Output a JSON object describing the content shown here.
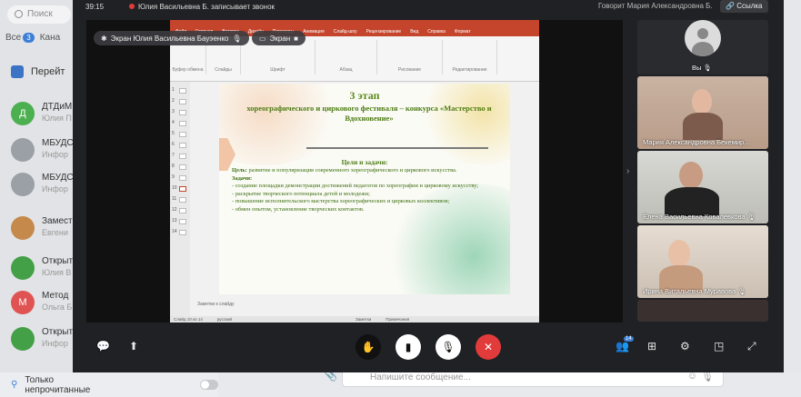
{
  "sidebar": {
    "search_placeholder": "Поиск",
    "filters": [
      {
        "label": "Все",
        "badge": "3"
      },
      {
        "label": "Кана"
      }
    ],
    "goto_label": "Перейт",
    "chats": [
      {
        "initial": "Д",
        "title": "ДТДиМ",
        "subtitle": "Юлия П",
        "color": "#4caf50"
      },
      {
        "initial": "",
        "title": "МБУДС",
        "subtitle": "Инфор",
        "color": "#9aa0a6"
      },
      {
        "initial": "",
        "title": "МБУДС",
        "subtitle": "Инфор",
        "color": "#9aa0a6"
      },
      {
        "initial": "",
        "title": "Замест",
        "subtitle": "Евгени",
        "color": "#c58a4b"
      },
      {
        "initial": "",
        "title": "Открыт",
        "subtitle": "Юлия В",
        "color": "#43a047"
      },
      {
        "initial": "М",
        "title": "Метод",
        "subtitle": "Ольга Б",
        "color": "#e05353"
      },
      {
        "initial": "",
        "title": "Открыт",
        "subtitle": "Инфор",
        "color": "#43a047"
      }
    ],
    "unread_toggle_label": "Только непрочитанные"
  },
  "composer": {
    "placeholder": "Напишите сообщение..."
  },
  "call": {
    "timer": "39:15",
    "recording_text": "Юлия Васильевна Б. записывает звонок",
    "speaking_text": "Говорит Мария Александровна Б.",
    "link_button": "Ссылка",
    "screen_chip_1": "Экран Юлия Васильевна Бауэенко",
    "screen_chip_2": "Экран",
    "participants": [
      {
        "name": "Вы"
      },
      {
        "name": "Мария Александровна Бекемир..."
      },
      {
        "name": "Елена Васильевна Ковалевкова"
      },
      {
        "name": "Ирина Витальевна Муравова"
      }
    ],
    "people_badge": "14"
  },
  "presentation": {
    "tabs": [
      "Файл",
      "Главная",
      "Вставка",
      "Дизайн",
      "Переходы",
      "Анимация",
      "Слайд-шоу",
      "Рецензирование",
      "Вид",
      "Справка",
      "Формат"
    ],
    "ribbon_groups": [
      "Буфер обмена",
      "Слайды",
      "Шрифт",
      "Абзац",
      "Рисование",
      "Редактирование"
    ],
    "slide_numbers": [
      "1",
      "2",
      "3",
      "4",
      "5",
      "6",
      "7",
      "8",
      "9",
      "10",
      "11",
      "12",
      "13",
      "14"
    ],
    "slide": {
      "stage": "3 этап",
      "title": "хореографического и циркового фестиваля – конкурса «Мастерство и Вдохновение»",
      "tasks_heading": "Цели и задачи:",
      "goal_label": "Цель:",
      "goal_text": " развитие и популяризация современного хореографического и циркового искусства.",
      "tasks_label": "Задачи:",
      "tasks": [
        "- создание площадки демонстрации достижений педагогов по хореографии и цирковому искусству;",
        "- раскрытие творческого потенциала детей и молодежи;",
        "- повышение исполнительского мастерства хореографических и цирковых коллективов;",
        "- обмен опытом, установление творческих контактов."
      ]
    },
    "notes_placeholder": "Заметки к слайду",
    "status_left": "Слайд 10 из 14",
    "status_lang": "русский",
    "status_notes": "Заметки",
    "status_comments": "Примечания"
  },
  "colors": {
    "hangup": "#e23b3b",
    "accent": "#3c7fd6",
    "slide_green": "#4e7d14"
  }
}
